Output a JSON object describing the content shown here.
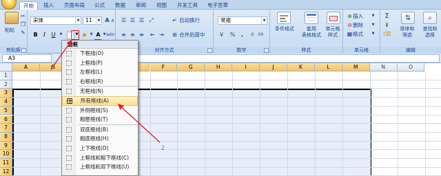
{
  "tabs": [
    "开始",
    "插入",
    "页面布局",
    "公式",
    "数据",
    "审阅",
    "视图",
    "开发工具",
    "电子签章"
  ],
  "active_tab": "开始",
  "clipboard": {
    "paste_label": "粘贴",
    "group_label": "剪贴板"
  },
  "font": {
    "name": "宋体",
    "size": "11",
    "bold": "B",
    "italic": "I",
    "underline": "U",
    "font_color_glyph": "A",
    "grow": "A",
    "shrink": "A",
    "phonetic": "wén"
  },
  "alignment": {
    "wrap_label": "自动换行",
    "merge_label": "合并后居中",
    "group_label": "对齐方式"
  },
  "number": {
    "format": "常规",
    "percent": "%",
    "comma": ",",
    "group_label": "数字"
  },
  "styles": {
    "conditional": "条件格式",
    "table_format": "套用\n表格格式",
    "cell_style": "单元格\n样式",
    "group_label": "样式"
  },
  "cells": {
    "insert": "插入",
    "delete": "删除",
    "format": "格式",
    "group_label": "单元格"
  },
  "editing": {
    "sigma": "Σ",
    "sort_filter": "排序和\n筛选",
    "find_select": "查找和\n选择",
    "group_label": "编辑"
  },
  "formula_bar": {
    "name_box": "A3"
  },
  "columns": [
    "A",
    "B",
    "C",
    "D",
    "E",
    "F",
    "G",
    "H",
    "I",
    "J",
    "K",
    "L",
    "M",
    "N",
    "O"
  ],
  "selected_columns": [
    "A",
    "B",
    "C",
    "D",
    "E",
    "F",
    "G",
    "H",
    "I",
    "J",
    "K",
    "L",
    "M"
  ],
  "rows": [
    "1",
    "2",
    "3",
    "4",
    "5",
    "6",
    "7",
    "8",
    "9",
    "10",
    "11",
    "12"
  ],
  "selected_rows": [
    "3",
    "4",
    "5",
    "6",
    "7",
    "8",
    "9",
    "10",
    "11",
    "12"
  ],
  "border_menu": {
    "header": "边框",
    "items": [
      {
        "label": "下框线(O)",
        "highlighted": false
      },
      {
        "label": "上框线(P)",
        "highlighted": false
      },
      {
        "label": "左框线(L)",
        "highlighted": false
      },
      {
        "label": "右框线(R)",
        "highlighted": false
      },
      {
        "label": "无框线(N)",
        "highlighted": false
      },
      {
        "label": "所有框线(A)",
        "highlighted": true
      },
      {
        "label": "外侧框线(S)",
        "highlighted": false
      },
      {
        "label": "粗匣框线(T)",
        "highlighted": false
      },
      {
        "label": "双底框线(B)",
        "highlighted": false
      },
      {
        "label": "粗底框线(H)",
        "highlighted": false
      },
      {
        "label": "上下框线(D)",
        "highlighted": false
      },
      {
        "label": "上框线和粗下框线(C)",
        "highlighted": false
      },
      {
        "label": "上框线和双下框线(U)",
        "highlighted": false
      }
    ]
  },
  "annotations": {
    "step1": "1",
    "step2": "2",
    "color": "#e02020"
  }
}
